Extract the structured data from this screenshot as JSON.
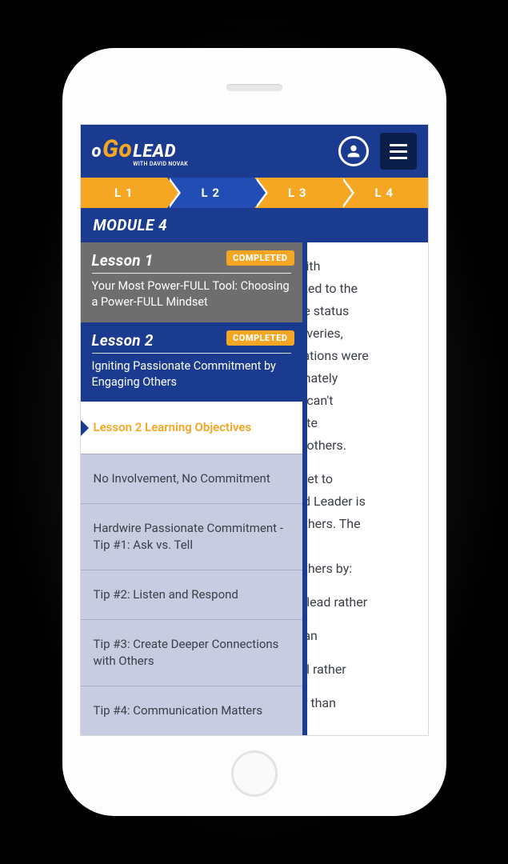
{
  "logo": {
    "o": "o",
    "go": "Go",
    "lead": "LEAD",
    "tagline": "WITH DAVID NOVAK"
  },
  "nav": {
    "l1": "L 1",
    "l2": "L 2",
    "l3": "L 3",
    "l4": "L 4"
  },
  "module": "MODULE 4",
  "lesson1": {
    "title": "Lesson 1",
    "badge": "COMPLETED",
    "desc": "Your Most Power-FULL Tool: Choosing a Power-FULL Mindset"
  },
  "lesson2": {
    "title": "Lesson 2",
    "badge": "COMPLETED",
    "desc": "Igniting Passionate Commitment by Engaging Others"
  },
  "sublist": {
    "i0": "Lesson 2 Learning Objectives",
    "i1": "No Involvement, No Commitment",
    "i2": "Hardwire Passionate Commitment - Tip #1: Ask vs. Tell",
    "i3": "Tip #2: Listen and Respond",
    "i4": "Tip #3: Create Deeper Connections with Others",
    "i5": "Tip #4: Communication Matters"
  },
  "bg": {
    "p1": "with\nitted to the\nne status\nioveries,\nzations were\nonately\nu can't\nnite\ng others.",
    "p2": "cret to\ned Leader is\nothers. The\nte\nothers by:",
    "p3": "u lead rather",
    "p4": "han",
    "p5": "all rather",
    "p6": "er than"
  }
}
